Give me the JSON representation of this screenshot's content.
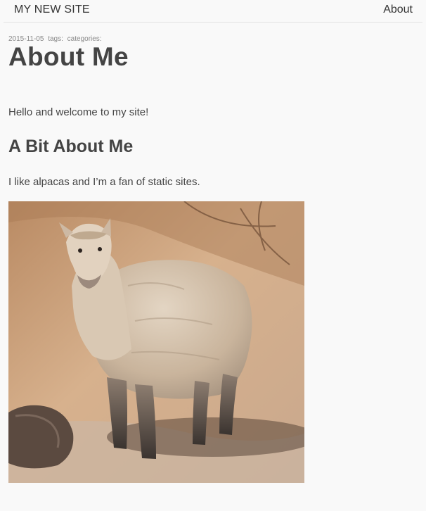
{
  "header": {
    "site_title": "MY NEW SITE",
    "nav_about": "About"
  },
  "post": {
    "date": "2015-11-05",
    "tags_label": "tags:",
    "categories_label": "categories:",
    "title": "About Me",
    "intro": "Hello and welcome to my site!",
    "section_heading": "A Bit About Me",
    "fact": "I like alpacas and I’m a fan of static sites.",
    "image": {
      "subject": "alpaca-photo"
    }
  }
}
